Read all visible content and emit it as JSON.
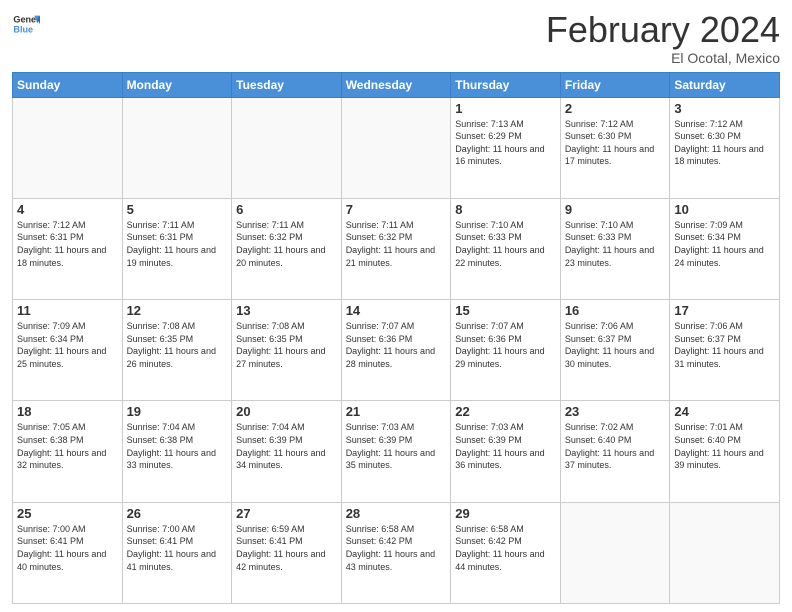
{
  "header": {
    "logo_line1": "General",
    "logo_line2": "Blue",
    "title": "February 2024",
    "subtitle": "El Ocotal, Mexico"
  },
  "days_of_week": [
    "Sunday",
    "Monday",
    "Tuesday",
    "Wednesday",
    "Thursday",
    "Friday",
    "Saturday"
  ],
  "weeks": [
    [
      {
        "day": "",
        "info": ""
      },
      {
        "day": "",
        "info": ""
      },
      {
        "day": "",
        "info": ""
      },
      {
        "day": "",
        "info": ""
      },
      {
        "day": "1",
        "info": "Sunrise: 7:13 AM\nSunset: 6:29 PM\nDaylight: 11 hours and 16 minutes."
      },
      {
        "day": "2",
        "info": "Sunrise: 7:12 AM\nSunset: 6:30 PM\nDaylight: 11 hours and 17 minutes."
      },
      {
        "day": "3",
        "info": "Sunrise: 7:12 AM\nSunset: 6:30 PM\nDaylight: 11 hours and 18 minutes."
      }
    ],
    [
      {
        "day": "4",
        "info": "Sunrise: 7:12 AM\nSunset: 6:31 PM\nDaylight: 11 hours and 18 minutes."
      },
      {
        "day": "5",
        "info": "Sunrise: 7:11 AM\nSunset: 6:31 PM\nDaylight: 11 hours and 19 minutes."
      },
      {
        "day": "6",
        "info": "Sunrise: 7:11 AM\nSunset: 6:32 PM\nDaylight: 11 hours and 20 minutes."
      },
      {
        "day": "7",
        "info": "Sunrise: 7:11 AM\nSunset: 6:32 PM\nDaylight: 11 hours and 21 minutes."
      },
      {
        "day": "8",
        "info": "Sunrise: 7:10 AM\nSunset: 6:33 PM\nDaylight: 11 hours and 22 minutes."
      },
      {
        "day": "9",
        "info": "Sunrise: 7:10 AM\nSunset: 6:33 PM\nDaylight: 11 hours and 23 minutes."
      },
      {
        "day": "10",
        "info": "Sunrise: 7:09 AM\nSunset: 6:34 PM\nDaylight: 11 hours and 24 minutes."
      }
    ],
    [
      {
        "day": "11",
        "info": "Sunrise: 7:09 AM\nSunset: 6:34 PM\nDaylight: 11 hours and 25 minutes."
      },
      {
        "day": "12",
        "info": "Sunrise: 7:08 AM\nSunset: 6:35 PM\nDaylight: 11 hours and 26 minutes."
      },
      {
        "day": "13",
        "info": "Sunrise: 7:08 AM\nSunset: 6:35 PM\nDaylight: 11 hours and 27 minutes."
      },
      {
        "day": "14",
        "info": "Sunrise: 7:07 AM\nSunset: 6:36 PM\nDaylight: 11 hours and 28 minutes."
      },
      {
        "day": "15",
        "info": "Sunrise: 7:07 AM\nSunset: 6:36 PM\nDaylight: 11 hours and 29 minutes."
      },
      {
        "day": "16",
        "info": "Sunrise: 7:06 AM\nSunset: 6:37 PM\nDaylight: 11 hours and 30 minutes."
      },
      {
        "day": "17",
        "info": "Sunrise: 7:06 AM\nSunset: 6:37 PM\nDaylight: 11 hours and 31 minutes."
      }
    ],
    [
      {
        "day": "18",
        "info": "Sunrise: 7:05 AM\nSunset: 6:38 PM\nDaylight: 11 hours and 32 minutes."
      },
      {
        "day": "19",
        "info": "Sunrise: 7:04 AM\nSunset: 6:38 PM\nDaylight: 11 hours and 33 minutes."
      },
      {
        "day": "20",
        "info": "Sunrise: 7:04 AM\nSunset: 6:39 PM\nDaylight: 11 hours and 34 minutes."
      },
      {
        "day": "21",
        "info": "Sunrise: 7:03 AM\nSunset: 6:39 PM\nDaylight: 11 hours and 35 minutes."
      },
      {
        "day": "22",
        "info": "Sunrise: 7:03 AM\nSunset: 6:39 PM\nDaylight: 11 hours and 36 minutes."
      },
      {
        "day": "23",
        "info": "Sunrise: 7:02 AM\nSunset: 6:40 PM\nDaylight: 11 hours and 37 minutes."
      },
      {
        "day": "24",
        "info": "Sunrise: 7:01 AM\nSunset: 6:40 PM\nDaylight: 11 hours and 39 minutes."
      }
    ],
    [
      {
        "day": "25",
        "info": "Sunrise: 7:00 AM\nSunset: 6:41 PM\nDaylight: 11 hours and 40 minutes."
      },
      {
        "day": "26",
        "info": "Sunrise: 7:00 AM\nSunset: 6:41 PM\nDaylight: 11 hours and 41 minutes."
      },
      {
        "day": "27",
        "info": "Sunrise: 6:59 AM\nSunset: 6:41 PM\nDaylight: 11 hours and 42 minutes."
      },
      {
        "day": "28",
        "info": "Sunrise: 6:58 AM\nSunset: 6:42 PM\nDaylight: 11 hours and 43 minutes."
      },
      {
        "day": "29",
        "info": "Sunrise: 6:58 AM\nSunset: 6:42 PM\nDaylight: 11 hours and 44 minutes."
      },
      {
        "day": "",
        "info": ""
      },
      {
        "day": "",
        "info": ""
      }
    ]
  ]
}
